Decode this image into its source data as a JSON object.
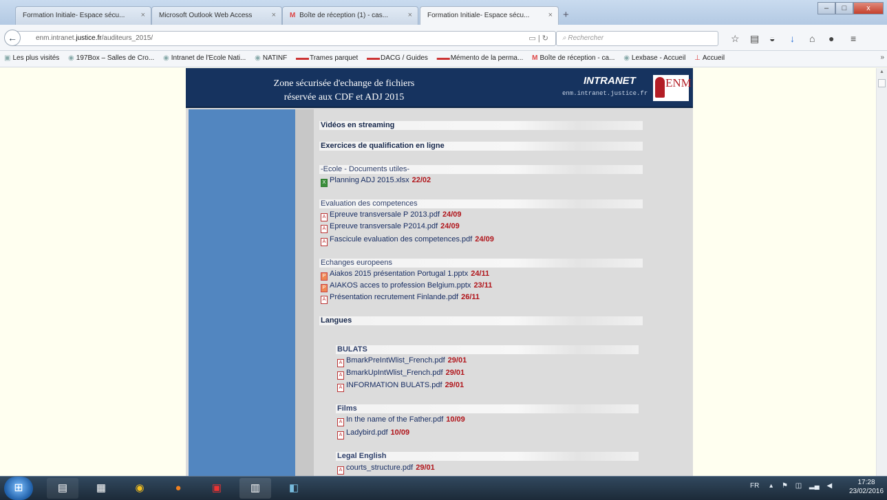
{
  "tabs": [
    {
      "label": "Formation Initiale- Espace sécu...",
      "close": "×"
    },
    {
      "label": "Microsoft Outlook Web Access",
      "close": "×"
    },
    {
      "label": "Boîte de réception (1) - cas...",
      "close": "×",
      "favicon": "M"
    },
    {
      "label": "Formation Initiale- Espace sécu...",
      "close": "×",
      "active": true
    }
  ],
  "newtab": "+",
  "window_controls": {
    "minimize": "–",
    "maximize": "□",
    "close": "x"
  },
  "url": {
    "prefix": "enm.intranet.",
    "domain": "justice.fr",
    "path": "/auditeurs_2015/"
  },
  "search_placeholder": "Rechercher",
  "bookmarks": [
    {
      "label": "Les plus visités"
    },
    {
      "label": "197Box – Salles de Cro..."
    },
    {
      "label": "Intranet de l'Ecole Nati..."
    },
    {
      "label": "NATINF"
    },
    {
      "label": "Trames parquet"
    },
    {
      "label": "DACG / Guides"
    },
    {
      "label": "Mémento de la perma..."
    },
    {
      "label": "Boîte de réception - ca..."
    },
    {
      "label": "Lexbase - Accueil"
    },
    {
      "label": "Accueil"
    }
  ],
  "bookmarks_more": "»",
  "site": {
    "title_line1": "Zone sécurisée d'echange de fichiers",
    "title_line2": "réservée aux CDF et ADJ 2015",
    "intranet": "INTRANET",
    "intranet_url": "enm.intranet.justice.fr",
    "logo_text": "ENM"
  },
  "sections": {
    "videos": "Vidéos en streaming",
    "exercices": "Exercices de qualification en ligne",
    "ecole": "-Ecole - Documents utiles-",
    "evaluation": "Evaluation des competences",
    "echanges": "Echanges europeens",
    "langues": "Langues",
    "bulats": "BULATS",
    "films": "Films",
    "legal": "Legal English"
  },
  "files": {
    "ecole": [
      {
        "name": "Planning ADJ 2015.xlsx",
        "date": "22/02",
        "icon": "xls"
      }
    ],
    "evaluation": [
      {
        "name": "Epreuve transversale P 2013.pdf",
        "date": "24/09",
        "icon": "pdf"
      },
      {
        "name": "Epreuve transversale P2014.pdf",
        "date": "24/09",
        "icon": "pdf"
      },
      {
        "name": "Fascicule evaluation des competences.pdf",
        "date": "24/09",
        "icon": "pdf"
      }
    ],
    "echanges": [
      {
        "name": "Aiakos 2015 présentation Portugal 1.pptx",
        "date": "24/11",
        "icon": "ppt"
      },
      {
        "name": "AIAKOS acces to profession Belgium.pptx",
        "date": "23/11",
        "icon": "ppt"
      },
      {
        "name": "Présentation recrutement Finlande.pdf",
        "date": "26/11",
        "icon": "pdf"
      }
    ],
    "bulats": [
      {
        "name": "BmarkPreIntWlist_French.pdf",
        "date": "29/01",
        "icon": "pdf"
      },
      {
        "name": "BmarkUpIntWlist_French.pdf",
        "date": "29/01",
        "icon": "pdf"
      },
      {
        "name": "INFORMATION BULATS.pdf",
        "date": "29/01",
        "icon": "pdf"
      }
    ],
    "films": [
      {
        "name": "In the name of the Father.pdf",
        "date": "10/09",
        "icon": "pdf"
      },
      {
        "name": "Ladybird.pdf",
        "date": "10/09",
        "icon": "pdf"
      }
    ],
    "legal": [
      {
        "name": "courts_structure.pdf",
        "date": "29/01",
        "icon": "pdf"
      }
    ]
  },
  "taskbar": {
    "lang": "FR",
    "time": "17:28",
    "date": "23/02/2016"
  }
}
